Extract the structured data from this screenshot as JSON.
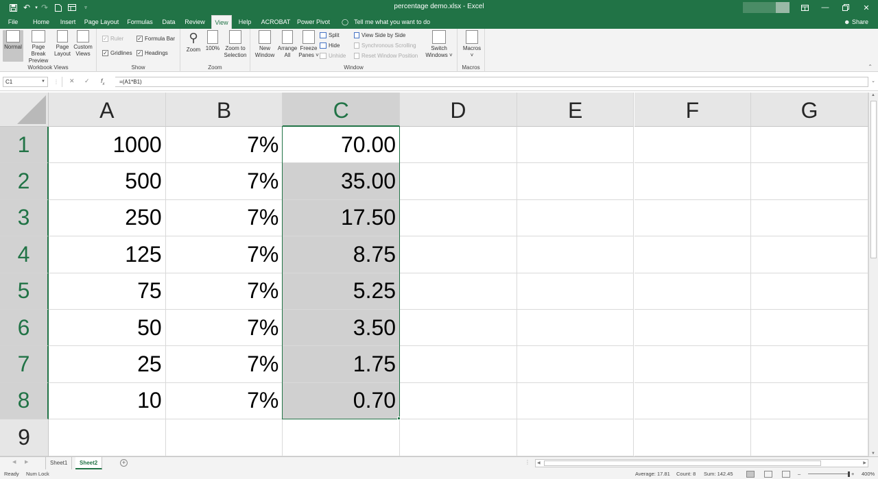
{
  "window": {
    "title": "percentage demo.xlsx  -  Excel",
    "quick_access": [
      "save-icon",
      "undo-icon",
      "redo-icon",
      "new-file-icon",
      "form-icon",
      "customize-icon"
    ]
  },
  "menu": {
    "tabs": [
      "File",
      "Home",
      "Insert",
      "Page Layout",
      "Formulas",
      "Data",
      "Review",
      "View",
      "Help",
      "ACROBAT",
      "Power Pivot"
    ],
    "active_tab": "View",
    "tell_me": "Tell me what you want to do",
    "share": "Share"
  },
  "ribbon": {
    "workbook_views": {
      "label": "Workbook Views",
      "normal": "Normal",
      "page_break_line1": "Page Break",
      "page_break_line2": "Preview",
      "page_layout_line1": "Page",
      "page_layout_line2": "Layout",
      "custom_line1": "Custom",
      "custom_line2": "Views"
    },
    "show": {
      "label": "Show",
      "ruler": "Ruler",
      "formula_bar": "Formula Bar",
      "gridlines": "Gridlines",
      "headings": "Headings"
    },
    "zoom": {
      "label": "Zoom",
      "zoom": "Zoom",
      "hundred": "100%",
      "zoom_sel_line1": "Zoom to",
      "zoom_sel_line2": "Selection"
    },
    "window": {
      "label": "Window",
      "new_line1": "New",
      "new_line2": "Window",
      "arrange_line1": "Arrange",
      "arrange_line2": "All",
      "freeze_line1": "Freeze",
      "freeze_line2": "Panes ˅",
      "split": "Split",
      "hide": "Hide",
      "unhide": "Unhide",
      "side_by_side": "View Side by Side",
      "sync_scroll": "Synchronous Scrolling",
      "reset_pos": "Reset Window Position",
      "switch_line1": "Switch",
      "switch_line2": "Windows ˅"
    },
    "macros": {
      "label": "Macros",
      "macros": "Macros"
    }
  },
  "formula_bar": {
    "name_box": "C1",
    "formula": "=(A1*B1)"
  },
  "sheet": {
    "columns": [
      "A",
      "B",
      "C",
      "D",
      "E",
      "F",
      "G"
    ],
    "selected_column": "C",
    "rows": [
      {
        "num": "1",
        "cells": [
          "1000",
          "7%",
          "70.00",
          "",
          "",
          "",
          ""
        ]
      },
      {
        "num": "2",
        "cells": [
          "500",
          "7%",
          "35.00",
          "",
          "",
          "",
          ""
        ]
      },
      {
        "num": "3",
        "cells": [
          "250",
          "7%",
          "17.50",
          "",
          "",
          "",
          ""
        ]
      },
      {
        "num": "4",
        "cells": [
          "125",
          "7%",
          "8.75",
          "",
          "",
          "",
          ""
        ]
      },
      {
        "num": "5",
        "cells": [
          "75",
          "7%",
          "5.25",
          "",
          "",
          "",
          ""
        ]
      },
      {
        "num": "6",
        "cells": [
          "50",
          "7%",
          "3.50",
          "",
          "",
          "",
          ""
        ]
      },
      {
        "num": "7",
        "cells": [
          "25",
          "7%",
          "1.75",
          "",
          "",
          "",
          ""
        ]
      },
      {
        "num": "8",
        "cells": [
          "10",
          "7%",
          "0.70",
          "",
          "",
          "",
          ""
        ]
      },
      {
        "num": "9",
        "cells": [
          "",
          "",
          "",
          "",
          "",
          "",
          ""
        ]
      }
    ]
  },
  "sheet_tabs": {
    "tabs": [
      "Sheet1",
      "Sheet2"
    ],
    "active": "Sheet2"
  },
  "status": {
    "ready": "Ready",
    "numlock": "Num Lock",
    "average": "Average: 17.81",
    "count": "Count: 8",
    "sum": "Sum: 142.45",
    "zoom": "400%"
  },
  "colors": {
    "accent": "#217346",
    "selection_fill": "#d0d0d0"
  }
}
